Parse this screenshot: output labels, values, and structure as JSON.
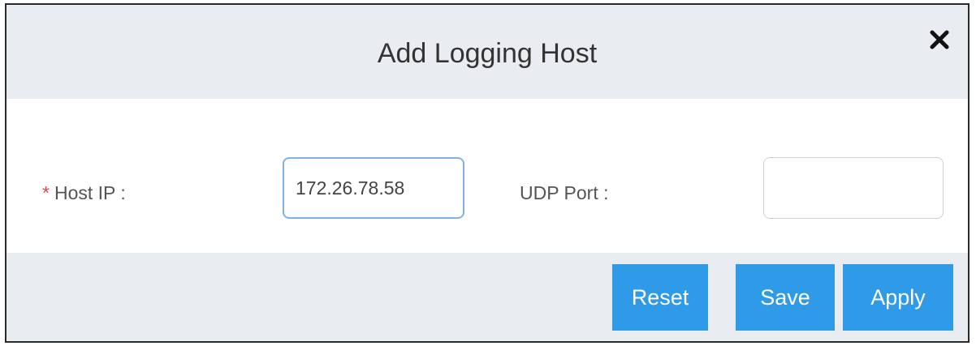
{
  "dialog": {
    "title": "Add Logging Host",
    "close_icon": "close-icon"
  },
  "form": {
    "host_ip": {
      "required_mark": "*",
      "label": "Host IP :",
      "value": "172.26.78.58"
    },
    "udp_port": {
      "label": "UDP Port :",
      "value": ""
    }
  },
  "footer": {
    "reset_label": "Reset",
    "save_label": "Save",
    "apply_label": "Apply"
  },
  "colors": {
    "header_bg": "#e9ecf0",
    "button_bg": "#2f9ae8",
    "required": "#e04848",
    "focus_border": "#7fb1e6"
  }
}
